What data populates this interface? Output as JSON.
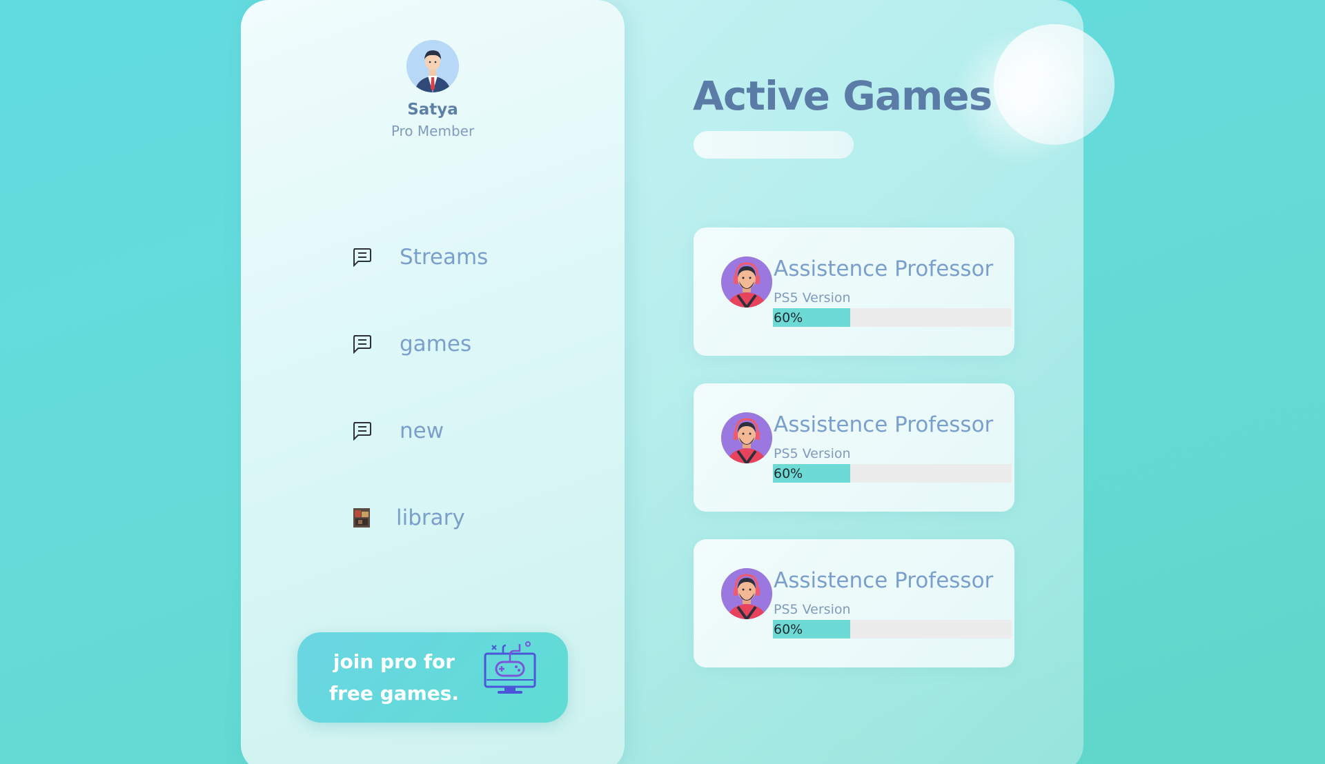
{
  "profile": {
    "name": "Satya",
    "role": "Pro Member",
    "avatar_icon": "businessman-avatar-icon"
  },
  "nav": {
    "items": [
      {
        "label": "Streams",
        "icon": "chat-bubble-icon"
      },
      {
        "label": "games",
        "icon": "chat-bubble-icon"
      },
      {
        "label": "new",
        "icon": "chat-bubble-icon"
      },
      {
        "label": "library",
        "icon": "game-thumbnail-icon"
      }
    ]
  },
  "promo": {
    "line1": "join pro for",
    "line2": "free games.",
    "icon": "gamepad-monitor-icon"
  },
  "main": {
    "title": "Active Games",
    "cards": [
      {
        "title": "Assistence Professor",
        "subtitle": "PS5 Version",
        "progress_label": "60%",
        "progress": 0.6,
        "avatar_icon": "gamer-headset-avatar-icon"
      },
      {
        "title": "Assistence Professor",
        "subtitle": "PS5 Version",
        "progress_label": "60%",
        "progress": 0.6,
        "avatar_icon": "gamer-headset-avatar-icon"
      },
      {
        "title": "Assistence Professor",
        "subtitle": "PS5 Version",
        "progress_label": "60%",
        "progress": 0.6,
        "avatar_icon": "gamer-headset-avatar-icon"
      }
    ]
  },
  "colors": {
    "background": "#62dbe0",
    "accent": "#6ddad5",
    "text_primary": "#5b7ca6",
    "text_secondary": "#7b9fcd",
    "promo": "#66d9dd"
  }
}
